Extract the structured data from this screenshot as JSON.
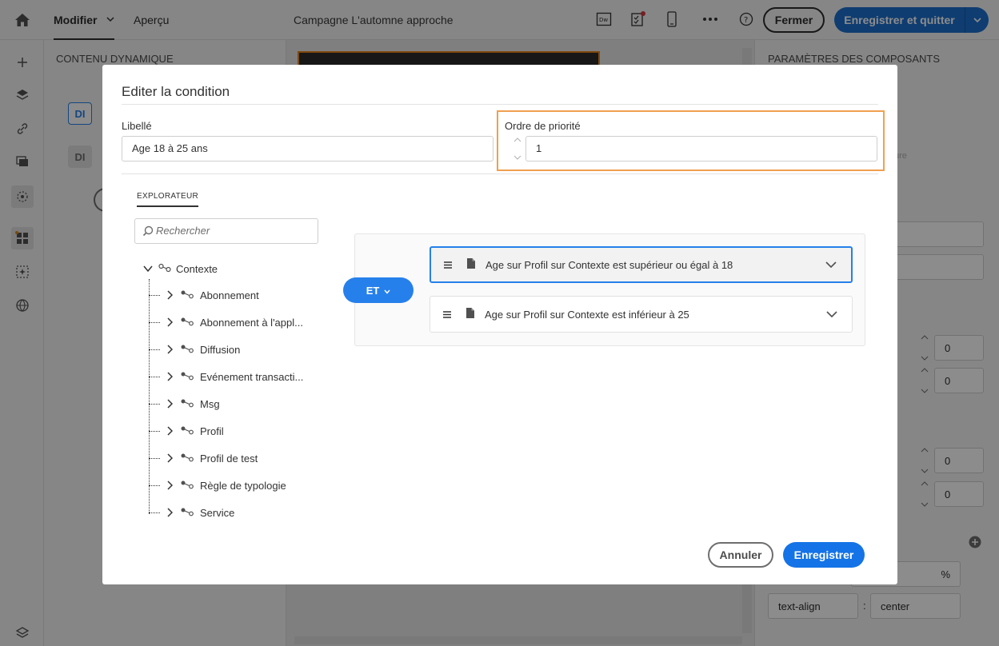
{
  "topbar": {
    "tab_modifier": "Modifier",
    "tab_apercu": "Aperçu",
    "document_title": "Campagne L'automne approche",
    "btn_fermer": "Fermer",
    "btn_save_quit": "Enregistrer et quitter"
  },
  "left_panel": {
    "title": "CONTENU DYNAMIQUE",
    "tag_1": "DI",
    "tag_2": "DI"
  },
  "right_panel": {
    "title": "PARAMÈTRES DES COMPOSANTS",
    "faded_text": "ure",
    "value_1": "0",
    "value_2": "0",
    "value_3": "0",
    "value_4": "0",
    "percent": "%",
    "css_prop": "text-align",
    "colon": ":",
    "css_value": "center"
  },
  "modal": {
    "title": "Editer la condition",
    "label_field": "Libellé",
    "label_value": "Age 18 à 25 ans",
    "priority_field": "Ordre de priorité",
    "priority_value": "1",
    "explorer_tab": "EXPLORATEUR",
    "search_placeholder": "Rechercher",
    "tree_root": "Contexte",
    "tree_items": [
      "Abonnement",
      "Abonnement à l'appl...",
      "Diffusion",
      "Evénement transacti...",
      "Msg",
      "Profil",
      "Profil de test",
      "Règle de typologie",
      "Service"
    ],
    "operator": "ET",
    "conditions": [
      "Age sur Profil sur Contexte est supérieur ou égal à 18",
      "Age sur Profil sur Contexte est inférieur à 25"
    ],
    "btn_cancel": "Annuler",
    "btn_save": "Enregistrer"
  },
  "colors": {
    "accent_blue": "#2680eb",
    "highlight_orange": "#f0a050"
  }
}
